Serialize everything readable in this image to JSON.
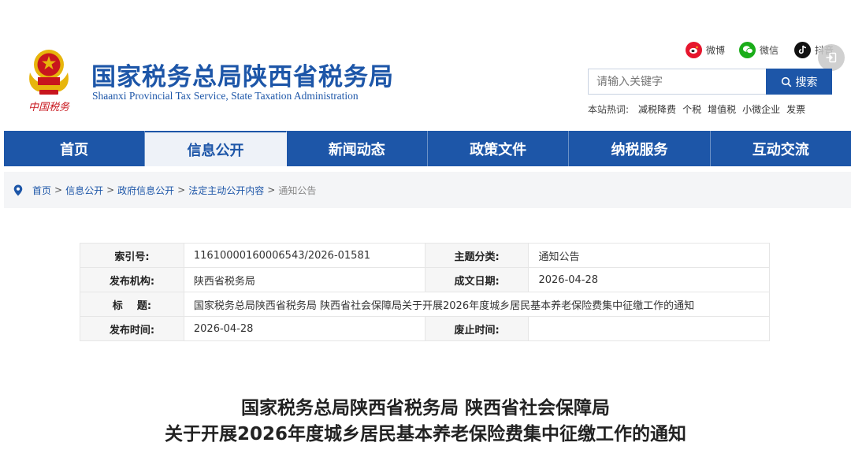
{
  "header": {
    "title": "国家税务总局陕西省税务局",
    "subtitle": "Shaanxi Provincial Tax Service, State Taxation Administration",
    "emblem_caption": "中国税务",
    "social": [
      {
        "label": "微博",
        "icon": "weibo-icon",
        "color": "#e6162d"
      },
      {
        "label": "微信",
        "icon": "wechat-icon",
        "color": "#1aad19"
      },
      {
        "label": "抖音",
        "icon": "douyin-icon",
        "color": "#111111"
      }
    ],
    "search": {
      "placeholder": "请输入关键字",
      "button_label": "搜索"
    },
    "hot_words": {
      "label": "本站热词:",
      "items": [
        "减税降费",
        "个税",
        "增值税",
        "小微企业",
        "发票"
      ]
    }
  },
  "nav": {
    "items": [
      "首页",
      "信息公开",
      "新闻动态",
      "政策文件",
      "纳税服务",
      "互动交流"
    ],
    "active_index": 1
  },
  "breadcrumb": [
    "首页",
    "信息公开",
    "政府信息公开",
    "法定主动公开内容",
    "通知公告"
  ],
  "info_table": {
    "index_label": "索引号:",
    "index_value": "11610000160006543/2026-01581",
    "topic_label": "主题分类:",
    "topic_value": "通知公告",
    "publisher_label": "发布机构:",
    "publisher_value": "陕西省税务局",
    "doc_date_label": "成文日期:",
    "doc_date_value": "2026-04-28",
    "title_label": "标    题:",
    "title_value": "国家税务总局陕西省税务局 陕西省社会保障局关于开展2026年度城乡居民基本养老保险费集中征缴工作的通知",
    "publish_time_label": "发布时间:",
    "publish_time_value": "2026-04-28",
    "expire_label": "废止时间:",
    "expire_value": ""
  },
  "article": {
    "title_line1": "国家税务总局陕西省税务局 陕西省社会保障局",
    "title_line2": "关于开展2026年度城乡居民基本养老保险费集中征缴工作的通知"
  },
  "colors": {
    "brand_blue": "#1d56a8",
    "emblem_red": "#c8161d",
    "emblem_gold": "#e7b50c"
  }
}
